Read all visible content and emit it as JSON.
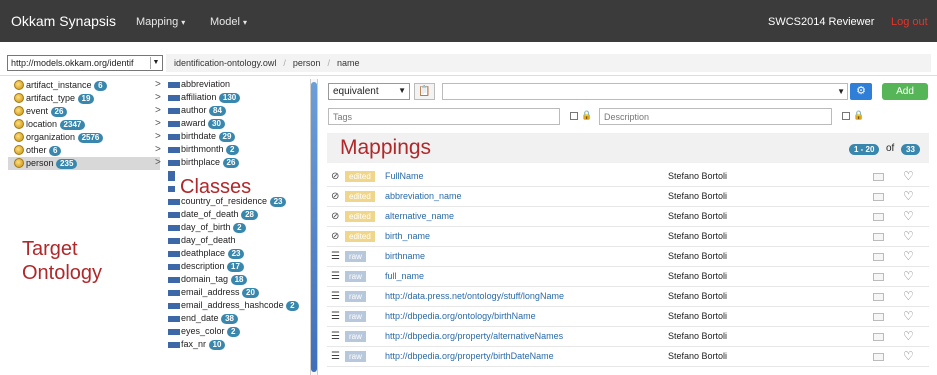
{
  "navbar": {
    "brand": "Okkam Synapsis",
    "menus": [
      {
        "label": "Mapping",
        "caret": "▾"
      },
      {
        "label": "Model",
        "caret": "▾"
      }
    ],
    "user": "SWCS2014 Reviewer",
    "logout": "Log out"
  },
  "breadcrumb": {
    "ontology_select": "http://models.okkam.org/identif",
    "items": [
      "identification-ontology.owl",
      "person",
      "name"
    ],
    "separator": "/"
  },
  "tree": {
    "items": [
      {
        "label": "artifact_instance",
        "count": "6"
      },
      {
        "label": "artifact_type",
        "count": "19"
      },
      {
        "label": "event",
        "count": "26"
      },
      {
        "label": "location",
        "count": "2347"
      },
      {
        "label": "organization",
        "count": "2576"
      },
      {
        "label": "other",
        "count": "6"
      },
      {
        "label": "person",
        "count": "235",
        "selected": true
      }
    ]
  },
  "classes": {
    "items": [
      {
        "label": "abbreviation",
        "count": ""
      },
      {
        "label": "affiliation",
        "count": "130"
      },
      {
        "label": "author",
        "count": "84"
      },
      {
        "label": "award",
        "count": "30"
      },
      {
        "label": "birthdate",
        "count": "29"
      },
      {
        "label": "birthmonth",
        "count": "2"
      },
      {
        "label": "birthplace",
        "count": "26"
      },
      {
        "label": "",
        "count": ""
      },
      {
        "label": "",
        "count": ""
      },
      {
        "label": "country_of_residence",
        "count": "23"
      },
      {
        "label": "date_of_death",
        "count": "28"
      },
      {
        "label": "day_of_birth",
        "count": "2"
      },
      {
        "label": "day_of_death",
        "count": ""
      },
      {
        "label": "deathplace",
        "count": "23"
      },
      {
        "label": "description",
        "count": "17"
      },
      {
        "label": "domain_tag",
        "count": "18"
      },
      {
        "label": "email_address",
        "count": "20"
      },
      {
        "label": "email_address_hashcode",
        "count": "2"
      },
      {
        "label": "end_date",
        "count": "38"
      },
      {
        "label": "eyes_color",
        "count": "2"
      },
      {
        "label": "fax_nr",
        "count": "10"
      }
    ]
  },
  "annotations": {
    "classes": "Classes",
    "target_line1": "Target",
    "target_line2": "Ontology"
  },
  "mapping_form": {
    "relation": "equivalent",
    "add_label": "Add",
    "tags_placeholder": "Tags",
    "description_placeholder": "Description"
  },
  "mappings": {
    "title": "Mappings",
    "page_range": "1 - 20",
    "of_label": "of",
    "total": "33",
    "rows": [
      {
        "type": "tag",
        "status": "edited",
        "label": "FullName",
        "author": "Stefano Bortoli"
      },
      {
        "type": "tag",
        "status": "edited",
        "label": "abbreviation_name",
        "author": "Stefano Bortoli"
      },
      {
        "type": "tag",
        "status": "edited",
        "label": "alternative_name",
        "author": "Stefano Bortoli"
      },
      {
        "type": "tag",
        "status": "edited",
        "label": "birth_name",
        "author": "Stefano Bortoli"
      },
      {
        "type": "lines",
        "status": "raw",
        "label": "birthname",
        "author": "Stefano Bortoli"
      },
      {
        "type": "lines",
        "status": "raw",
        "label": "full_name",
        "author": "Stefano Bortoli"
      },
      {
        "type": "lines",
        "status": "raw",
        "label": "http://data.press.net/ontology/stuff/longName",
        "author": "Stefano Bortoli"
      },
      {
        "type": "lines",
        "status": "raw",
        "label": "http://dbpedia.org/ontology/birthName",
        "author": "Stefano Bortoli"
      },
      {
        "type": "lines",
        "status": "raw",
        "label": "http://dbpedia.org/property/alternativeNames",
        "author": "Stefano Bortoli"
      },
      {
        "type": "lines",
        "status": "raw",
        "label": "http://dbpedia.org/property/birthDateName",
        "author": "Stefano Bortoli"
      }
    ]
  },
  "colors": {
    "navbar": "#3b3b3b",
    "logout": "#e4342b",
    "annotation_red": "#b0282a",
    "badge_blue": "#3a87ad",
    "add_green": "#56b556",
    "edited_yellow": "#f0d68a",
    "raw_blue": "#b8c8dc"
  }
}
